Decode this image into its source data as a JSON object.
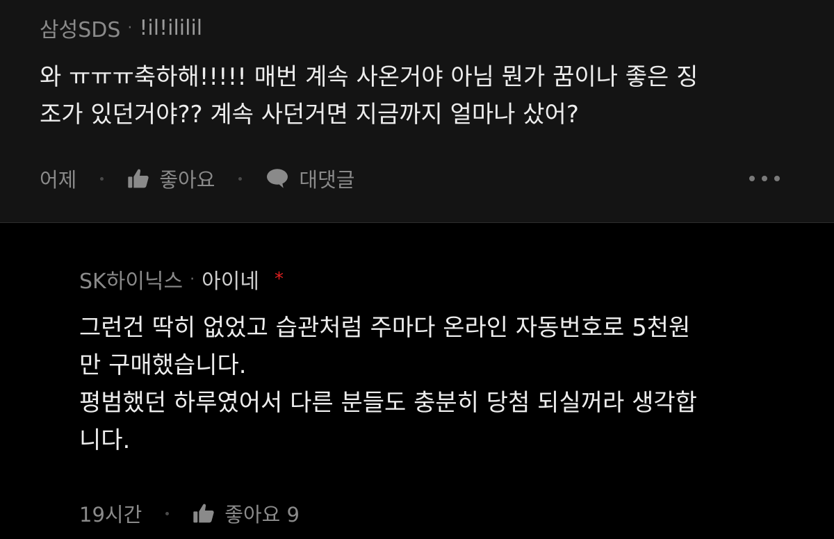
{
  "comment1": {
    "author": "삼성SDS",
    "nickname": "!il!ililil",
    "text": "와 ㅠㅠㅠ축하해!!!!! 매번 계속 사온거야 아님 뭔가 꿈이나 좋은 징\n조가 있던거야?? 계속 사던거면 지금까지 얼마나 샀어?",
    "time": "어제",
    "like_label": "좋아요",
    "reply_label": "대댓글"
  },
  "comment2": {
    "author": "SK하이닉스",
    "nickname": "아이네",
    "badge": "*",
    "text": "그런건 딱히 없었고 습관처럼 주마다 온라인 자동번호로 5천원\n만 구매했습니다.\n평범했던 하루였어서 다른 분들도 충분히 당첨 되실꺼라 생각합\n니다.",
    "time": "19시간",
    "like_label": "좋아요 9"
  },
  "icons": {
    "dot": "·",
    "thumb": "thumbs-up-icon",
    "reply": "speech-bubble-icon",
    "more": "more-dots-icon"
  },
  "colors": {
    "background": "#000000",
    "comment_bg": "#141414",
    "meta_text": "#8a8a8a",
    "body_text": "#ededed",
    "accent_red": "#e02020"
  }
}
